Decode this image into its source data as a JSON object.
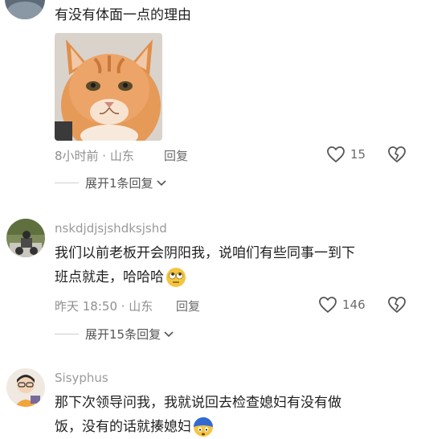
{
  "comment1": {
    "text": "有没有体面一点的理由",
    "meta": "8小时前 · 山东",
    "reply_label": "回复",
    "likes": "15",
    "expand_label": "展开1条回复",
    "image_icon": "cat-photo"
  },
  "comment2": {
    "username": "nskdjdjsjshdksjshd",
    "text_line1": "我们以前老板开会阴阳我，说咱们有些同事一到下",
    "text_line2": "班点就走，哈哈哈",
    "emoji_icon": "rolling-eyes-emoji",
    "meta": "昨天 18:50 · 山东",
    "reply_label": "回复",
    "likes": "146",
    "expand_label": "展开15条回复"
  },
  "comment3": {
    "username": "Sisyphus",
    "text_line1": "那下次领导问我，我就说回去检查媳妇有没有做",
    "text_line2": "饭，没有的话就揍媳妇",
    "emoji_icon": "blue-face-emoji"
  },
  "icons": {
    "like": "heart-outline-icon",
    "dislike": "broken-heart-icon",
    "chevron": "chevron-down-icon"
  }
}
